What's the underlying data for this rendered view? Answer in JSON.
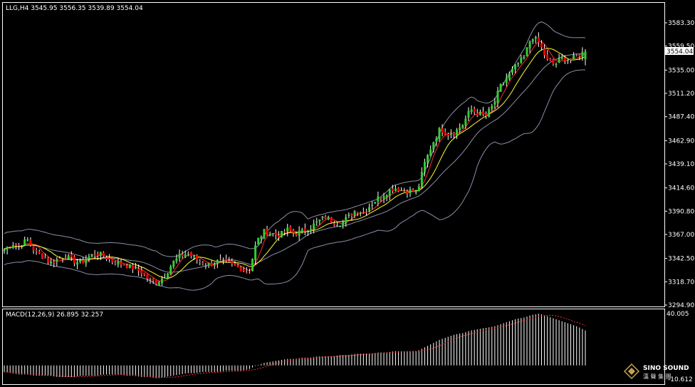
{
  "header": {
    "symbol_line": "LLG,H4  3545.95 3556.35 3539.89 3554.04",
    "macd_line": "MACD(12,26,9) 26.895 32.257"
  },
  "colors": {
    "background": "#000000",
    "frame": "#ffffff",
    "bull": "#33cc33",
    "bear": "#ff0000",
    "bands": "#8a8fa8",
    "ma_fast": "#ff2a2a",
    "ma_slow": "#ffff33",
    "macd_hist": "#ffffff",
    "macd_signal": "#ff2a2a",
    "logo": "#c8a24a"
  },
  "price_axis": {
    "ticks": [
      "3583.30",
      "3559.50",
      "3535.00",
      "3511.20",
      "3487.40",
      "3462.90",
      "3439.10",
      "3414.60",
      "3390.80",
      "3367.00",
      "3342.50",
      "3318.70",
      "3294.90"
    ],
    "current_price": "3554.04"
  },
  "macd_axis": {
    "ticks": [
      "40.005",
      "-10.612"
    ]
  },
  "logo": {
    "name": "SINO SOUND",
    "subtitle": "漢 聲 集 團"
  },
  "chart_data": {
    "type": "candlestick",
    "timeframe": "H4",
    "symbol": "LLG",
    "ylim": [
      3294.9,
      3590
    ],
    "last_bar": {
      "open": 3545.95,
      "high": 3556.35,
      "low": 3539.89,
      "close": 3554.04
    },
    "anchors_close": [
      3352,
      3358,
      3355,
      3362,
      3350,
      3345,
      3338,
      3342,
      3345,
      3340,
      3338,
      3344,
      3348,
      3345,
      3340,
      3338,
      3335,
      3332,
      3328,
      3320,
      3318,
      3325,
      3338,
      3345,
      3348,
      3342,
      3338,
      3336,
      3340,
      3338,
      3335,
      3332,
      3328,
      3360,
      3370,
      3368,
      3366,
      3372,
      3368,
      3370,
      3374,
      3380,
      3385,
      3380,
      3378,
      3385,
      3392,
      3390,
      3398,
      3405,
      3410,
      3415,
      3412,
      3412,
      3410,
      3440,
      3460,
      3475,
      3470,
      3472,
      3480,
      3495,
      3490,
      3488,
      3500,
      3520,
      3530,
      3540,
      3548,
      3570,
      3562,
      3545,
      3540,
      3548,
      3545,
      3550,
      3554.04
    ],
    "macd_anchors": [
      -5,
      -6,
      -7,
      -7,
      -8,
      -8,
      -8,
      -9,
      -9,
      -9,
      -8,
      -8,
      -8,
      -7,
      -7,
      -7,
      -8,
      -8,
      -9,
      -9,
      -10,
      -9,
      -8,
      -7,
      -6,
      -6,
      -5,
      -5,
      -5,
      -4,
      -4,
      -4,
      -3,
      0,
      2,
      3,
      4,
      5,
      5,
      6,
      6,
      7,
      7,
      7,
      8,
      8,
      9,
      9,
      9,
      10,
      10,
      11,
      11,
      11,
      11,
      14,
      17,
      20,
      22,
      24,
      25,
      27,
      28,
      29,
      30,
      32,
      34,
      36,
      37,
      39,
      40,
      38,
      36,
      34,
      32,
      30,
      27
    ],
    "macd_values": {
      "main": 26.895,
      "signal": 32.257
    },
    "ma_periods": [
      "fast",
      "slow"
    ],
    "bands": "bollinger"
  }
}
